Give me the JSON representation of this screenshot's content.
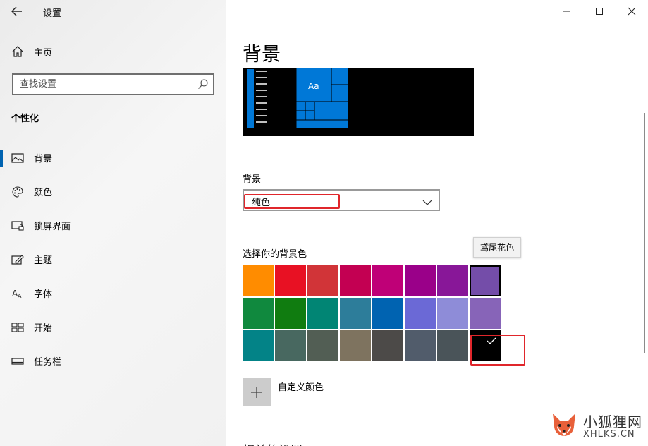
{
  "app": {
    "title": "设置"
  },
  "sidebar": {
    "home": "主页",
    "search_placeholder": "查找设置",
    "section_title": "个性化",
    "items": [
      {
        "label": "背景",
        "icon": "picture-icon",
        "active": true
      },
      {
        "label": "颜色",
        "icon": "palette-icon"
      },
      {
        "label": "锁屏界面",
        "icon": "lock-screen-icon"
      },
      {
        "label": "主题",
        "icon": "theme-icon"
      },
      {
        "label": "字体",
        "icon": "font-icon"
      },
      {
        "label": "开始",
        "icon": "start-icon"
      },
      {
        "label": "任务栏",
        "icon": "taskbar-icon"
      }
    ]
  },
  "main": {
    "page_title": "背景",
    "preview_tile_text": "Aa",
    "background_label": "背景",
    "background_value": "纯色",
    "color_label": "选择你的背景色",
    "tooltip": "鸢尾花色",
    "custom_color_label": "自定义颜色",
    "cutoff_heading": "相关的设置"
  },
  "swatches": [
    [
      "#ff8c00",
      "#e81123",
      "#d13438",
      "#c30052",
      "#bf0077",
      "#9a0089",
      "#881798",
      "#744da9"
    ],
    [
      "#10893e",
      "#107c10",
      "#018574",
      "#2d7d9a",
      "#0063b1",
      "#6b69d6",
      "#8e8cd8",
      "#8764b8"
    ],
    [
      "#038387",
      "#486860",
      "#525e54",
      "#7e735f",
      "#4c4a48",
      "#515c6b",
      "#4a5459",
      "#000000"
    ]
  ],
  "colors": {
    "accent": "#0078d7",
    "highlight": "#e0262b"
  },
  "watermark": {
    "title": "小狐狸网",
    "url": "XHLKS.CN"
  }
}
